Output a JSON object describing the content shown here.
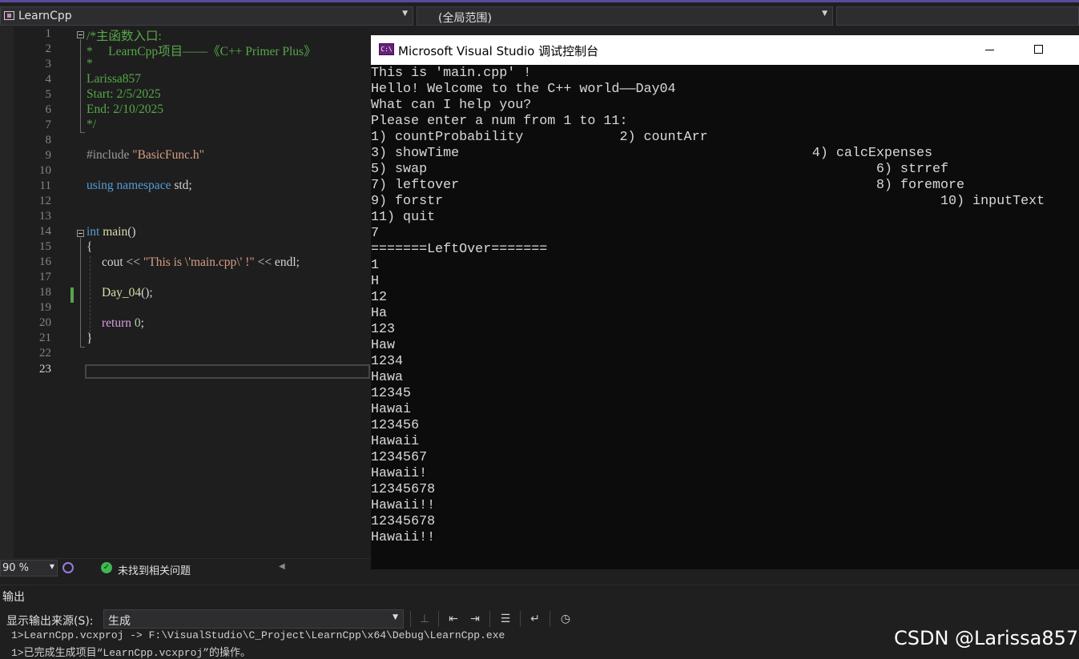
{
  "navbar": {
    "project": "LearnCpp",
    "scope": "(全局范围)"
  },
  "editor": {
    "line_numbers": [
      "1",
      "2",
      "3",
      "4",
      "5",
      "6",
      "7",
      "8",
      "9",
      "10",
      "11",
      "12",
      "13",
      "14",
      "15",
      "16",
      "17",
      "18",
      "19",
      "20",
      "21",
      "22",
      "23"
    ],
    "current_line": "23",
    "code": {
      "l1": "/*主函数入口:",
      "l2": "*     LearnCpp项目——《C++ Primer Plus》",
      "l3": "*",
      "l4": "Larissa857",
      "l5": "Start: 2/5/2025",
      "l6": "End: 2/10/2025",
      "l7": "*/",
      "l9_include": "#include ",
      "l9_file": "\"BasicFunc.h\"",
      "l11_using": "using namespace",
      "l11_std": " std;",
      "l14_int": "int",
      "l14_main": "main",
      "l14_paren": "()",
      "l15": "{",
      "l16_cout": "cout << ",
      "l16_str": "\"This is \\'main.cpp\\' !\"",
      "l16_end": " << endl;",
      "l18_fn": "Day_04",
      "l18_end": "();",
      "l20_return": "return",
      "l20_num": " 0",
      "l20_semi": ";",
      "l21": "}"
    }
  },
  "status": {
    "zoom": "90 %",
    "issues": "未找到相关问题"
  },
  "console": {
    "icon_label": "C:\\",
    "title": "Microsoft Visual Studio 调试控制台",
    "lines": [
      "This is 'main.cpp' !",
      "Hello! Welcome to the C++ world——Day04",
      "What can I help you?",
      "Please enter a num from 1 to 11:",
      "1) countProbability            2) countArr",
      "3) showTime                                            4) calcExpenses",
      "5) swap                                                        6) strref",
      "7) leftover                                                    8) foremore",
      "9) forstr                                                              10) inputText",
      "11) quit",
      "7",
      "=======LeftOver=======",
      "1",
      "H",
      "12",
      "Ha",
      "123",
      "Haw",
      "1234",
      "Hawa",
      "12345",
      "Hawai",
      "123456",
      "Hawaii",
      "1234567",
      "Hawaii!",
      "12345678",
      "Hawaii!!",
      "12345678",
      "Hawaii!!"
    ]
  },
  "output": {
    "title": "输出",
    "source_label": "显示输出来源(S):",
    "source_value": "生成",
    "lines": [
      "1>LearnCpp.vcxproj -> F:\\VisualStudio\\C_Project\\LearnCpp\\x64\\Debug\\LearnCpp.exe",
      "1>已完成生成项目“LearnCpp.vcxproj”的操作。"
    ]
  },
  "watermark": "CSDN @Larissa857"
}
